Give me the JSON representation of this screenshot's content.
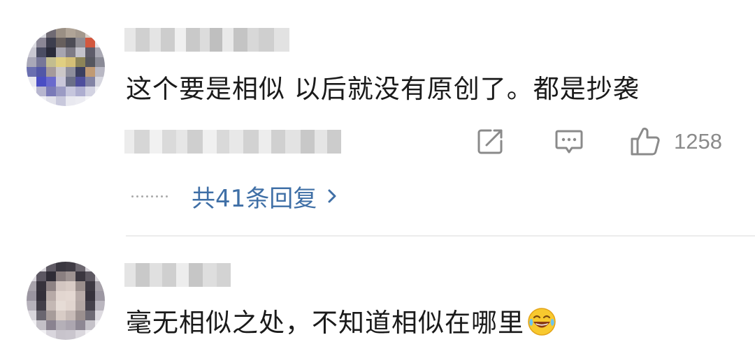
{
  "comments": [
    {
      "text": "这个要是相似 以后就没有原创了。都是抄袭",
      "likes": "1258",
      "replies_label": "共41条回复"
    },
    {
      "text": "毫无相似之处，不知道相似在哪里"
    }
  ],
  "icons": {
    "share": "share-icon",
    "comment": "comment-icon",
    "like": "thumbs-up-icon",
    "more": "dots-icon",
    "chevron": "chevron-right-icon",
    "emoji": "laugh-cry-emoji"
  },
  "colors": {
    "text": "#1a1a1a",
    "meta": "#8a8a8a",
    "link": "#3f6fa6",
    "divider": "#ececec"
  }
}
